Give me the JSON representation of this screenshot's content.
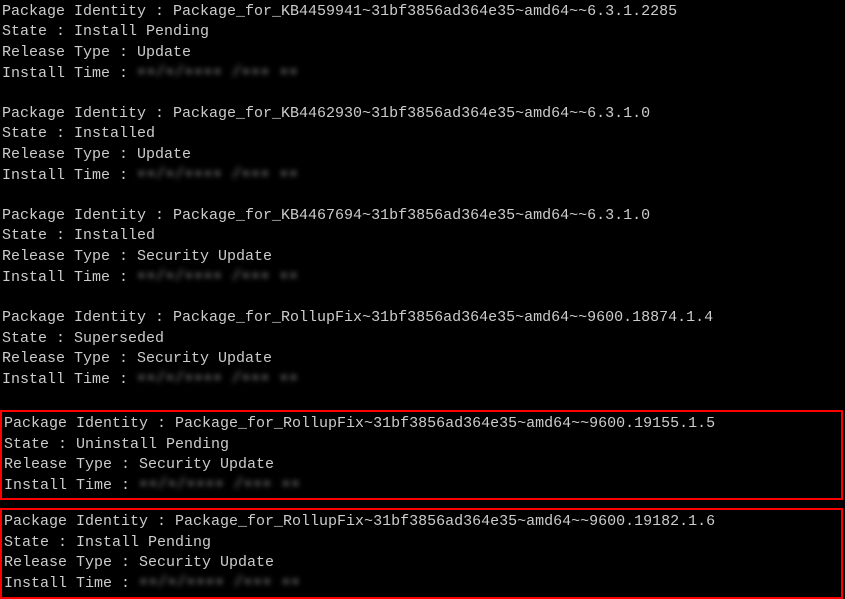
{
  "labels": {
    "package_identity": "Package Identity : ",
    "state": "State : ",
    "release_type": "Release Type : ",
    "install_time": "Install Time : "
  },
  "redacted_time": "▪▪/▪/▪▪▪▪ /▪▪▪ ▪▪",
  "packages": [
    {
      "identity": "Package_for_KB4459941~31bf3856ad364e35~amd64~~6.3.1.2285",
      "state": "Install Pending",
      "release_type": "Update",
      "highlighted": false
    },
    {
      "identity": "Package_for_KB4462930~31bf3856ad364e35~amd64~~6.3.1.0",
      "state": "Installed",
      "release_type": "Update",
      "highlighted": false
    },
    {
      "identity": "Package_for_KB4467694~31bf3856ad364e35~amd64~~6.3.1.0",
      "state": "Installed",
      "release_type": "Security Update",
      "highlighted": false
    },
    {
      "identity": "Package_for_RollupFix~31bf3856ad364e35~amd64~~9600.18874.1.4",
      "state": "Superseded",
      "release_type": "Security Update",
      "highlighted": false
    },
    {
      "identity": "Package_for_RollupFix~31bf3856ad364e35~amd64~~9600.19155.1.5",
      "state": "Uninstall Pending",
      "release_type": "Security Update",
      "highlighted": true
    },
    {
      "identity": "Package_for_RollupFix~31bf3856ad364e35~amd64~~9600.19182.1.6",
      "state": "Install Pending",
      "release_type": "Security Update",
      "highlighted": true
    }
  ]
}
